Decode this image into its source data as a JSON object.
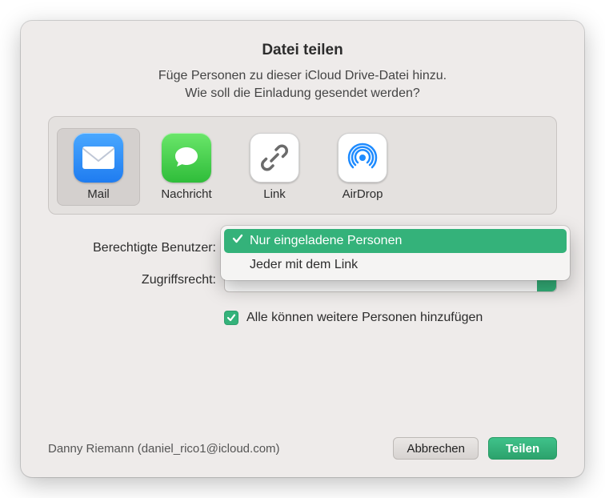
{
  "title": "Datei teilen",
  "subtitle_line1": "Füge Personen zu dieser iCloud Drive-Datei hinzu.",
  "subtitle_line2": "Wie soll die Einladung gesendet werden?",
  "share_methods": {
    "mail": {
      "label": "Mail",
      "selected": true
    },
    "message": {
      "label": "Nachricht",
      "selected": false
    },
    "link": {
      "label": "Link",
      "selected": false
    },
    "airdrop": {
      "label": "AirDrop",
      "selected": false
    }
  },
  "form": {
    "allowed_users_label": "Berechtigte Benutzer:",
    "permission_label": "Zugriffsrecht:",
    "dropdown_options": {
      "only_invited": "Nur eingeladene Personen",
      "anyone_link": "Jeder mit dem Link"
    },
    "checkbox_label": "Alle können weitere Personen hinzufügen",
    "checkbox_checked": true
  },
  "footer": {
    "account": "Danny Riemann (daniel_rico1@icloud.com)",
    "cancel": "Abbrechen",
    "share": "Teilen"
  },
  "colors": {
    "accent": "#34b27a"
  }
}
